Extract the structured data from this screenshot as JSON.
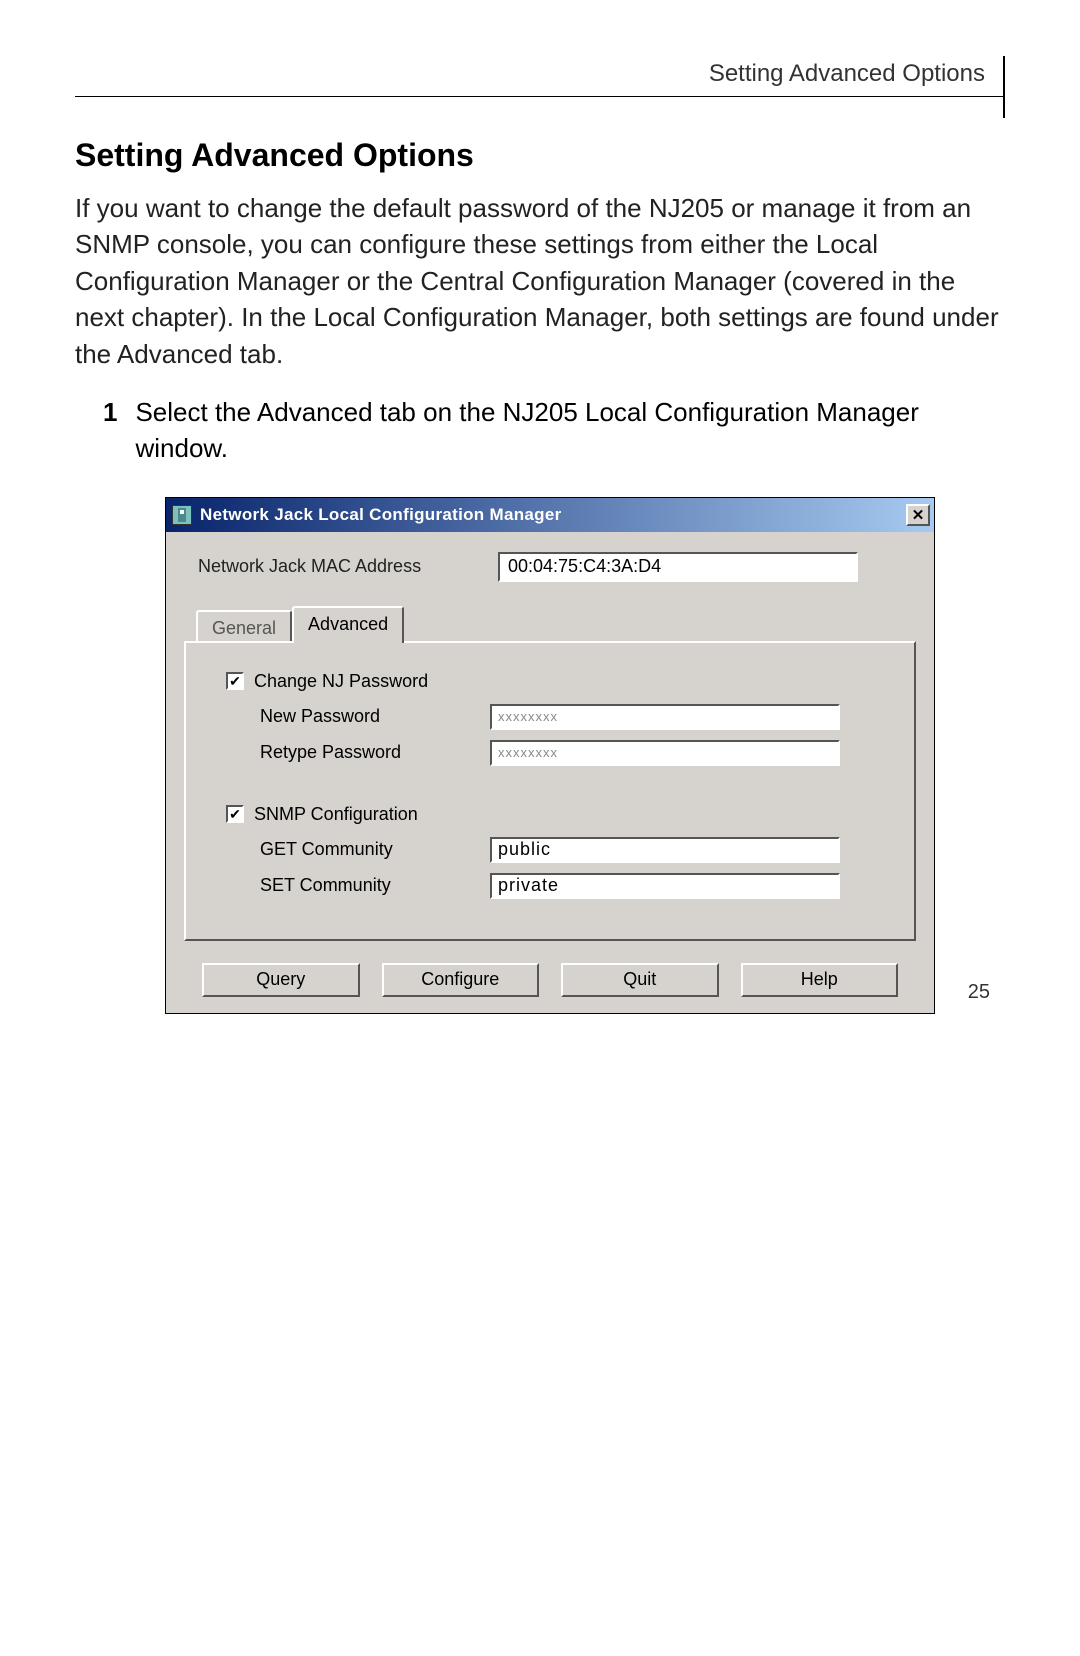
{
  "page_header": "Setting Advanced Options",
  "section_title": "Setting Advanced Options",
  "intro_paragraph": "If you want to change the default password of the NJ205 or manage it from an SNMP console, you can configure these settings from either the Local Configuration Manager or the Central Configuration Manager (covered in the next chapter). In the Local Configuration Manager, both settings are found under the Advanced tab.",
  "steps": {
    "1": "Select the Advanced tab on the NJ205 Local Configuration Manager window."
  },
  "window": {
    "title": "Network Jack Local Configuration Manager",
    "close_glyph": "✕",
    "mac_label": "Network Jack MAC Address",
    "mac_value": "00:04:75:C4:3A:D4",
    "tabs": {
      "general": "General",
      "advanced": "Advanced"
    },
    "chk_password_label": "Change NJ Password",
    "chk_password_mark": "✔",
    "new_pwd_label": "New Password",
    "new_pwd_value": "xxxxxxxx",
    "retype_pwd_label": "Retype Password",
    "retype_pwd_value": "xxxxxxxx",
    "chk_snmp_label": "SNMP Configuration",
    "chk_snmp_mark": "✔",
    "get_label": "GET Community",
    "get_value": "public",
    "set_label": "SET Community",
    "set_value": "private",
    "buttons": {
      "query": "Query",
      "configure": "Configure",
      "quit": "Quit",
      "help": "Help"
    }
  },
  "page_number": "25"
}
